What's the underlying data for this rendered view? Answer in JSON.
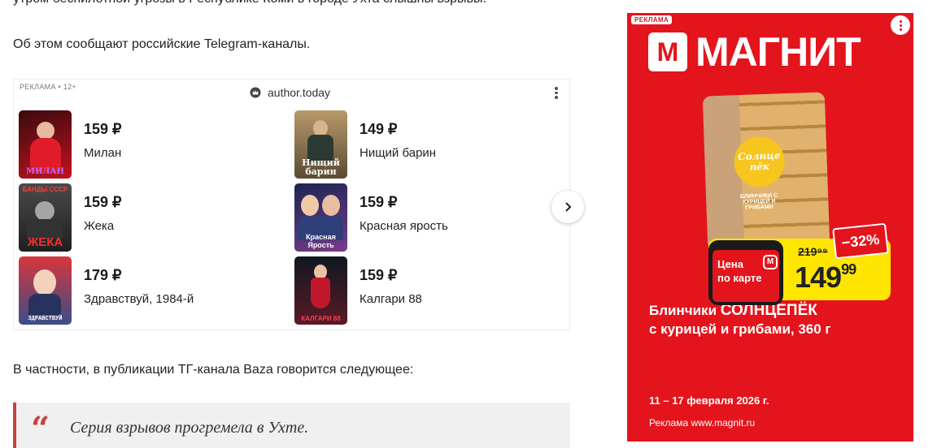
{
  "article": {
    "paragraph_cut": "утром беспилотной угрозы в Республике Коми в городе Ухта слышны взрывы.",
    "paragraph_source": "Об этом сообщают российские Telegram-каналы.",
    "paragraph_baza": "В частности, в публикации ТГ-канала Baza говорится следующее:",
    "quote": "Серия взрывов прогремела в Ухте.",
    "quote_mark": "“"
  },
  "ad": {
    "label": "РЕКЛАМА • 12+",
    "source": "author.today",
    "books": [
      {
        "price": "159 ₽",
        "title": "Милан",
        "cover_text": "МИЛАН",
        "cover_colors": [
          "#3a0a0e",
          "#c1121f"
        ]
      },
      {
        "price": "149 ₽",
        "title": "Нищий барин",
        "cover_text": "Нищий барин",
        "cover_colors": [
          "#5b4a35",
          "#b79a6a"
        ]
      },
      {
        "price": "159 ₽",
        "title": "Жека",
        "cover_text": "ЖЕКА",
        "cover_top": "БАНДЫ СССР",
        "cover_colors": [
          "#2b2b2b",
          "#6a6a6a"
        ]
      },
      {
        "price": "159 ₽",
        "title": "Красная ярость",
        "cover_text": "Красная Ярость",
        "cover_colors": [
          "#1b2650",
          "#7a3b8c"
        ]
      },
      {
        "price": "179 ₽",
        "title": "Здравствуй, 1984-й",
        "cover_text": "ЗДРАВСТВУЙ",
        "cover_colors": [
          "#d8353a",
          "#3b4d8a"
        ]
      },
      {
        "price": "159 ₽",
        "title": "Калгари 88",
        "cover_text": "КАЛГАРИ 88",
        "cover_colors": [
          "#101820",
          "#5a1a26"
        ]
      }
    ],
    "icons": {
      "source": "crown-icon",
      "menu": "more-vertical-icon",
      "next": "chevron-right-icon"
    }
  },
  "banner": {
    "label": "РЕКЛАМА",
    "brand_letter": "М",
    "brand_name": "МАГНИТ",
    "product_badge": "Солнце пёк",
    "product_sub": "БЛИНЧИКИ С КУРИЦЕЙ И ГРИБАМИ",
    "discount": "−32%",
    "old_price": "219⁹⁹",
    "price_main": "149",
    "price_cents": "99",
    "card_label_1": "Цена",
    "card_label_2": "по карте",
    "name_line1_a": "Блинчики ",
    "name_line1_b": "СОЛНЦЕПЁК",
    "name_line2": "с курицей и грибами, 360 г",
    "dates": "11 – 17 февраля 2026 г.",
    "site": "Реклама www.magnit.ru",
    "colors": {
      "red": "#e4141c",
      "yellow": "#ffe600"
    }
  }
}
